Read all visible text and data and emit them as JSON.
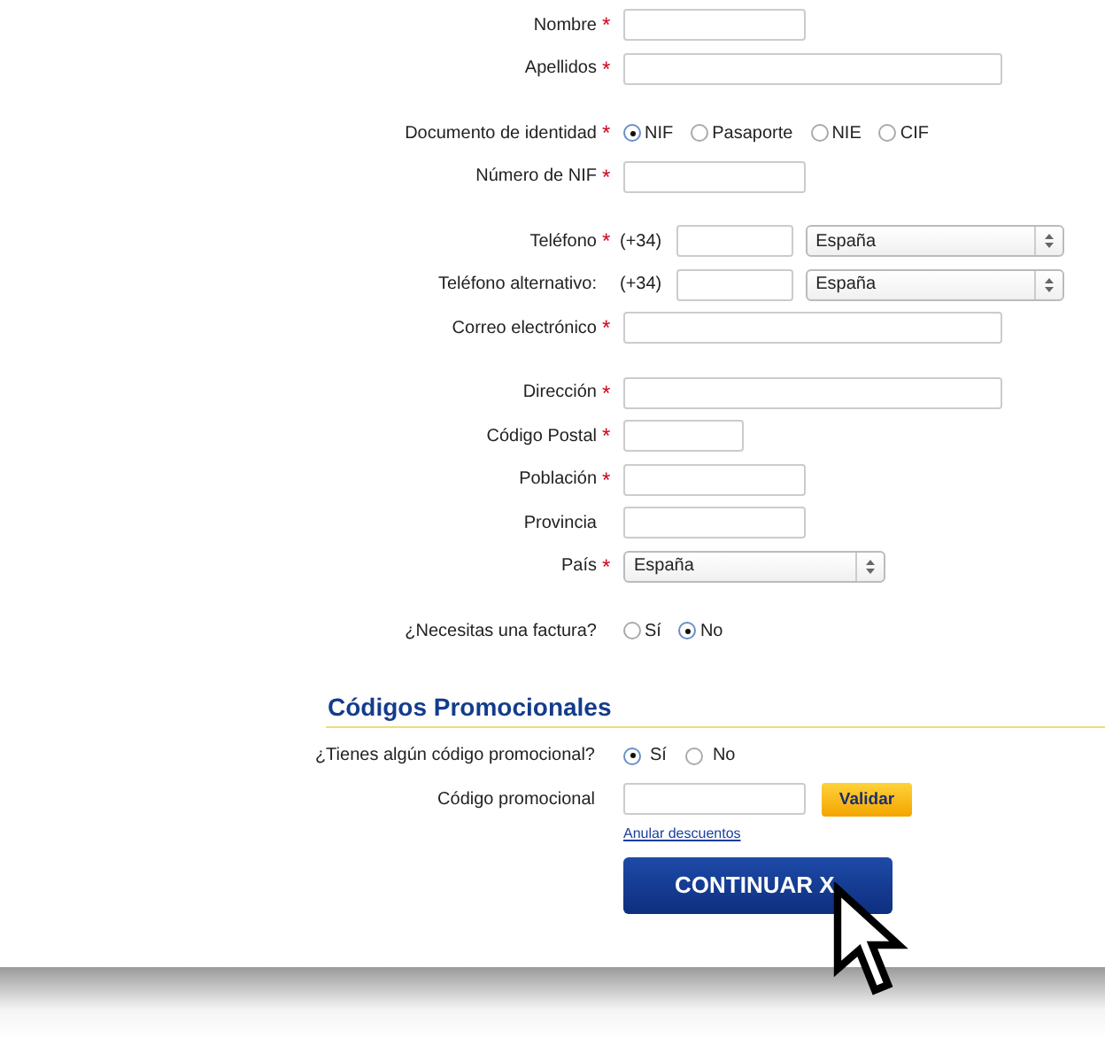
{
  "groups": [
    {
      "fields": [
        {
          "kind": "short",
          "label": "Nombre",
          "required_mark": "*"
        },
        {
          "kind": "long",
          "label": "Apellidos",
          "required_mark": "*"
        }
      ]
    },
    {
      "fields": [
        {
          "kind": "radio",
          "label": "Documento de identidad",
          "required_mark": "*",
          "options": [
            {
              "label": "NIF",
              "selected": true
            },
            {
              "label": "Pasaporte",
              "selected": false
            },
            {
              "label": "NIE",
              "selected": false
            },
            {
              "label": "CIF",
              "selected": false
            }
          ]
        },
        {
          "kind": "short",
          "label": "Número de NIF",
          "required_mark": "*"
        }
      ]
    },
    {
      "fields": [
        {
          "kind": "phone",
          "label": "Teléfono",
          "required_mark": "*",
          "prefix": "(+34)",
          "value": "España"
        },
        {
          "kind": "phone",
          "label": "Teléfono alternativo:",
          "prefix": "(+34)",
          "value": "España"
        },
        {
          "kind": "long",
          "label": "Correo electrónico",
          "required_mark": "*"
        }
      ]
    },
    {
      "fields": [
        {
          "kind": "long",
          "label": "Dirección",
          "required_mark": "*"
        },
        {
          "kind": "tiny",
          "label": "Código Postal",
          "required_mark": "*"
        },
        {
          "kind": "short",
          "label": "Población",
          "required_mark": "*"
        },
        {
          "kind": "short",
          "label": "Provincia"
        },
        {
          "kind": "select",
          "label": "País",
          "required_mark": "*",
          "value": "España"
        }
      ]
    },
    {
      "fields": [
        {
          "kind": "radio",
          "label": "¿Necesitas una factura?",
          "options": [
            {
              "label": "Sí",
              "selected": false
            },
            {
              "label": "No",
              "selected": true
            }
          ]
        }
      ]
    }
  ],
  "promo": {
    "title": "Códigos Promocionales",
    "question": {
      "label": "¿Tienes algún código promocional?",
      "options": [
        {
          "label": "Sí",
          "selected": true
        },
        {
          "label": "No",
          "selected": false
        }
      ]
    },
    "code_label": "Código promocional",
    "validate_button": "Validar",
    "link": "Anular descuentos",
    "continue_button": "CONTINUAR X"
  }
}
